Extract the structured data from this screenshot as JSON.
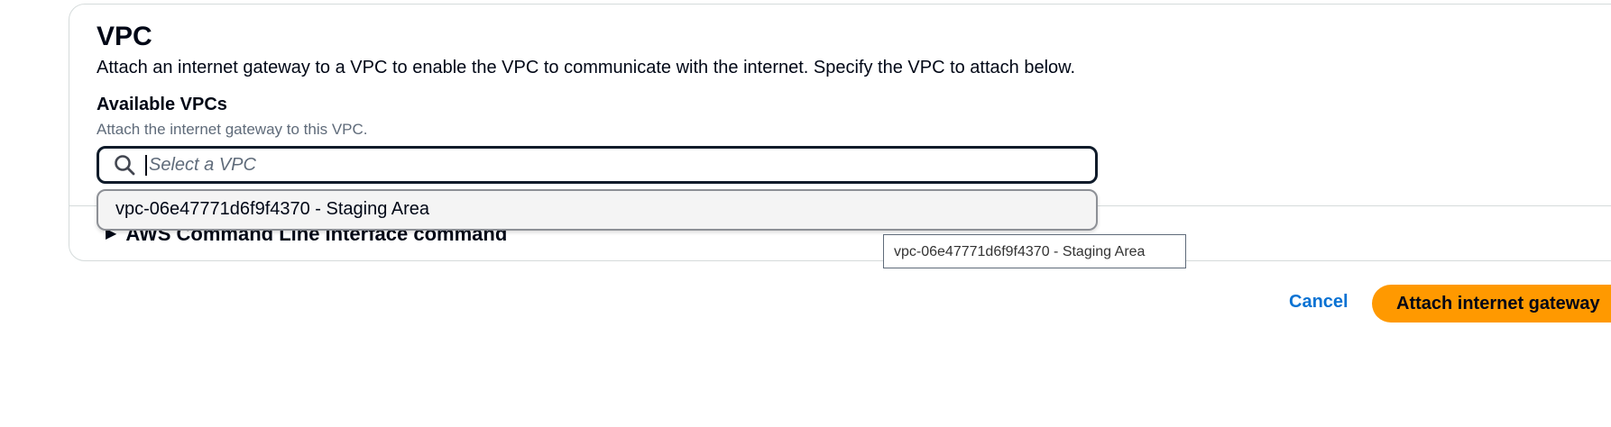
{
  "vpc_section": {
    "title": "VPC",
    "description": "Attach an internet gateway to a VPC to enable the VPC to communicate with the internet. Specify the VPC to attach below."
  },
  "available_vpcs": {
    "label": "Available VPCs",
    "description": "Attach the internet gateway to this VPC.",
    "search_placeholder": "Select a VPC",
    "search_value": "",
    "options": [
      {
        "label": "vpc-06e47771d6f9f4370 - Staging Area"
      }
    ]
  },
  "cli_expander": {
    "caret": "▶",
    "label": "AWS Command Line Interface command"
  },
  "tooltip": {
    "text": "vpc-06e47771d6f9f4370 - Staging Area"
  },
  "actions": {
    "cancel_label": "Cancel",
    "submit_label": "Attach internet gateway"
  },
  "colors": {
    "primary_button": "#ff9900",
    "link": "#0972d3",
    "focus_border": "#0f1b2a",
    "text": "#000716"
  },
  "icons": {
    "search": "search-icon"
  }
}
